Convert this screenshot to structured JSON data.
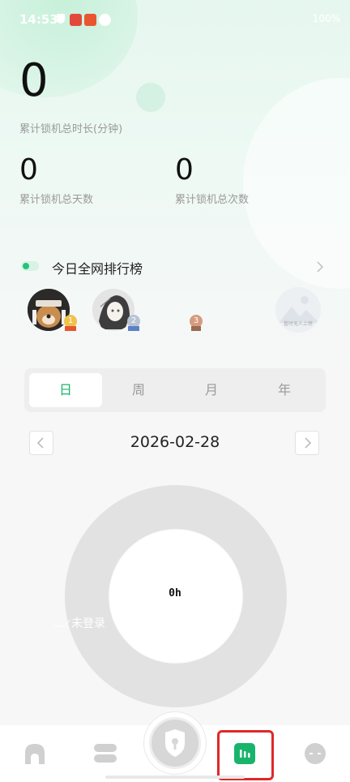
{
  "status_bar": {
    "time": "14:53",
    "right_text": "100%"
  },
  "stats": {
    "total_minutes": {
      "value": "0",
      "label": "累计锁机总时长(分钟)"
    },
    "total_days": {
      "value": "0",
      "label": "累计锁机总天数"
    },
    "total_count": {
      "value": "0",
      "label": "累计锁机总次数"
    }
  },
  "ranking": {
    "title": "今日全网排行榜",
    "ranks": [
      "1",
      "2",
      "3"
    ],
    "empty_avatar_caption": "暂时无人上榜"
  },
  "period_tabs": [
    {
      "label": "日",
      "active": true
    },
    {
      "label": "周",
      "active": false
    },
    {
      "label": "月",
      "active": false
    },
    {
      "label": "年",
      "active": false
    }
  ],
  "date_nav": {
    "date": "2026-02-28"
  },
  "chart_data": {
    "type": "pie",
    "categories": [
      "未登录"
    ],
    "values": [
      0
    ],
    "center_label": "0h"
  },
  "colors": {
    "accent": "#19b46b",
    "donut": "#e2e2e2",
    "highlight": "#e02828"
  },
  "bottom_nav": [
    {
      "icon": "home-icon"
    },
    {
      "icon": "layers-icon"
    },
    {
      "icon": "lock-shield-icon"
    },
    {
      "icon": "statistics-icon",
      "active": true
    },
    {
      "icon": "profile-face-icon"
    }
  ]
}
